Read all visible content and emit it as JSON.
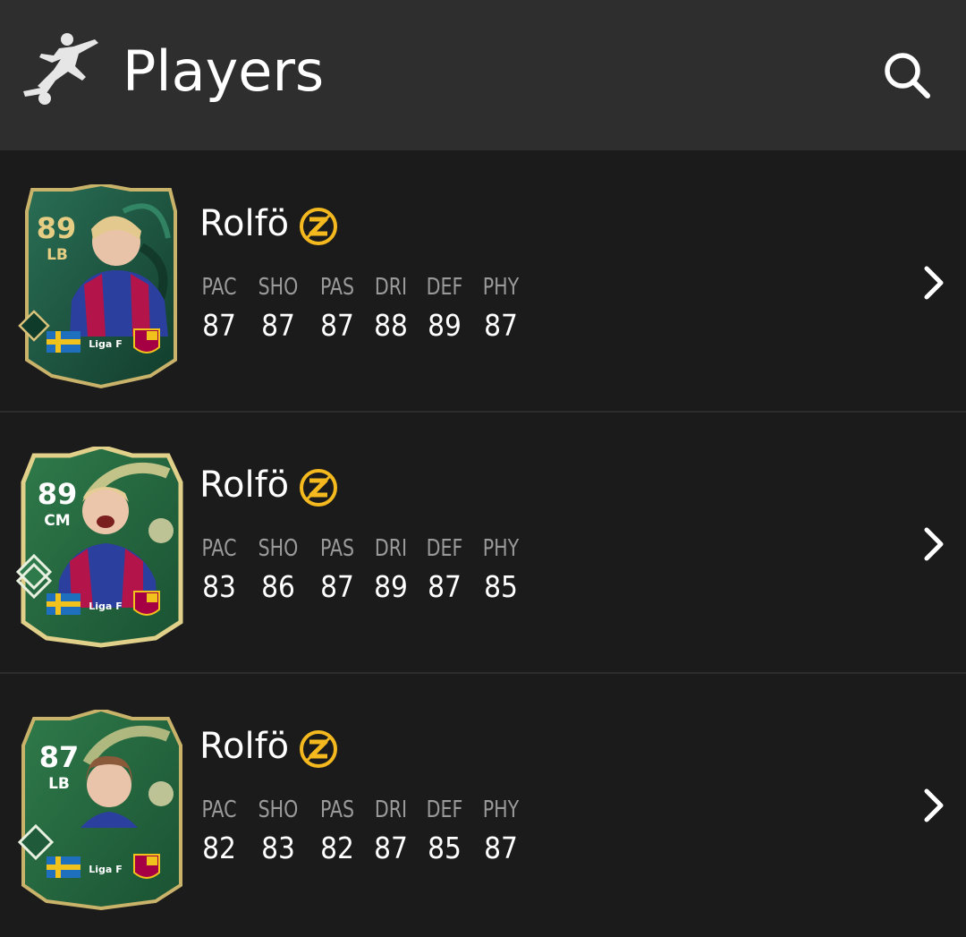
{
  "header": {
    "title": "Players",
    "logo_icon": "footballer-kicking-icon",
    "search_icon": "search-icon"
  },
  "players": [
    {
      "name": "Rolfö",
      "badge_icon": "evolution-badge-icon",
      "rating": "89",
      "position": "LB",
      "league": "Liga F",
      "card_theme": "dark-green-tropical",
      "stats": [
        {
          "label": "PAC",
          "value": "87"
        },
        {
          "label": "SHO",
          "value": "87"
        },
        {
          "label": "PAS",
          "value": "87"
        },
        {
          "label": "DRI",
          "value": "88"
        },
        {
          "label": "DEF",
          "value": "89"
        },
        {
          "label": "PHY",
          "value": "87"
        }
      ]
    },
    {
      "name": "Rolfö",
      "badge_icon": "evolution-badge-icon",
      "rating": "89",
      "position": "CM",
      "league": "Liga F",
      "card_theme": "green-winter",
      "stats": [
        {
          "label": "PAC",
          "value": "83"
        },
        {
          "label": "SHO",
          "value": "86"
        },
        {
          "label": "PAS",
          "value": "87"
        },
        {
          "label": "DRI",
          "value": "89"
        },
        {
          "label": "DEF",
          "value": "87"
        },
        {
          "label": "PHY",
          "value": "85"
        }
      ]
    },
    {
      "name": "Rolfö",
      "badge_icon": "evolution-badge-icon",
      "rating": "87",
      "position": "LB",
      "league": "Liga F",
      "card_theme": "green-winter",
      "stats": [
        {
          "label": "PAC",
          "value": "82"
        },
        {
          "label": "SHO",
          "value": "83"
        },
        {
          "label": "PAS",
          "value": "82"
        },
        {
          "label": "DRI",
          "value": "87"
        },
        {
          "label": "DEF",
          "value": "85"
        },
        {
          "label": "PHY",
          "value": "87"
        }
      ]
    }
  ],
  "colors": {
    "header_bg": "#2e2e2e",
    "list_bg": "#1b1b1b",
    "badge_gold": "#f4b91e",
    "card_green": "#1f5a3a",
    "card_gold_border": "#c9b26a",
    "stat_label": "#9a9a9a"
  }
}
